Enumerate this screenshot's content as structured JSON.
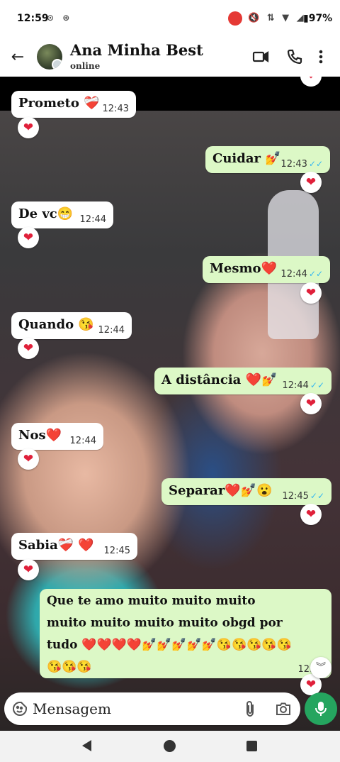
{
  "status_bar": {
    "time": "12:59",
    "left_icons": "⊙ ⊛",
    "right_icons": "🔇 ⇅ ▼ ◢",
    "battery": "▮97%"
  },
  "header": {
    "contact_name": "Ana Minha Best",
    "contact_status": "online",
    "back_icon": "←"
  },
  "messages": [
    {
      "direction": "in",
      "text": "Prometo ❤️‍🩹",
      "time": "12:43",
      "reaction": "❤"
    },
    {
      "direction": "out",
      "text": "Cuidar 💅",
      "time": "12:43",
      "reaction": "❤"
    },
    {
      "direction": "in",
      "text": "De vc😁",
      "time": "12:44",
      "reaction": "❤"
    },
    {
      "direction": "out",
      "text": "Mesmo❤️",
      "time": "12:44",
      "reaction": "❤"
    },
    {
      "direction": "in",
      "text": "Quando 😘",
      "time": "12:44",
      "reaction": "❤"
    },
    {
      "direction": "out",
      "text": "A distância ❤️💅",
      "time": "12:44",
      "reaction": "❤"
    },
    {
      "direction": "in",
      "text": "Nos❤️",
      "time": "12:44",
      "reaction": "❤"
    },
    {
      "direction": "out",
      "text": "Separar❤️💅😮",
      "time": "12:45",
      "reaction": "❤"
    },
    {
      "direction": "in",
      "text": "Sabia❤️‍🩹 ❤️",
      "time": "12:45",
      "reaction": "❤"
    },
    {
      "direction": "out",
      "text": "Que te amo muito muito muito muito muito muito muito obgd por tudo ❤️❤️❤️❤️💅💅💅💅💅😘😘😘😘😘😘😘😘",
      "time": "12:48",
      "reaction": "❤"
    }
  ],
  "read_tick": "✓✓",
  "top_partial_reaction": "❤",
  "scroll_down_icon": "︾",
  "input": {
    "placeholder": "Mensagem"
  },
  "colors": {
    "incoming_bubble": "#ffffff",
    "outgoing_bubble": "#dcf8c6",
    "mic_button": "#25a55f",
    "read_tick": "#34b7f1",
    "reaction_heart": "#e0203a"
  }
}
